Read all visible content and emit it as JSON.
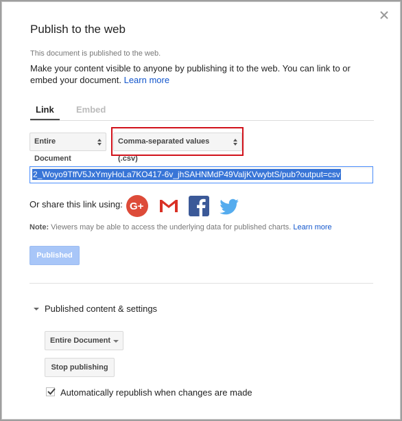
{
  "dialog": {
    "title": "Publish to the web",
    "status": "This document is published to the web.",
    "description": "Make your content visible to anyone by publishing it to the web. You can link to or embed your document.",
    "learn_more": "Learn more"
  },
  "tabs": [
    {
      "label": "Link",
      "active": true
    },
    {
      "label": "Embed",
      "active": false
    }
  ],
  "selectors": {
    "scope": "Entire Document",
    "format": "Comma-separated values (.csv)"
  },
  "url": {
    "value": "2_Woyo9TffV5JxYmyHoLa7KO417-6v_jhSAHNMdP49ValjKVwybtS/pub?output=csv"
  },
  "share": {
    "label": "Or share this link using:",
    "icons": [
      "google-plus-icon",
      "gmail-icon",
      "facebook-icon",
      "twitter-icon"
    ]
  },
  "note": {
    "prefix": "Note:",
    "text": " Viewers may be able to access the underlying data for published charts.",
    "learn_more": "Learn more"
  },
  "publish_button": {
    "label": "Published"
  },
  "settings": {
    "toggle_label": "Published content & settings",
    "scope": "Entire Document",
    "stop_label": "Stop publishing",
    "auto_republish_label": "Automatically republish when changes are made",
    "auto_republish_checked": true
  },
  "colors": {
    "accent": "#1155cc",
    "highlight": "#d1111a",
    "google_plus": "#dd4b39",
    "facebook": "#3b5998",
    "twitter": "#55acee"
  }
}
